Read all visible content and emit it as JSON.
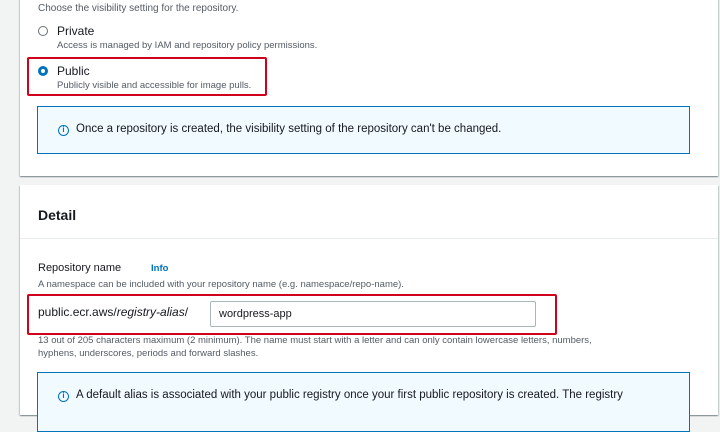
{
  "visibility": {
    "description": "Choose the visibility setting for the repository.",
    "options": [
      {
        "label": "Private",
        "description": "Access is managed by IAM and repository policy permissions.",
        "selected": false
      },
      {
        "label": "Public",
        "description": "Publicly visible and accessible for image pulls.",
        "selected": true
      }
    ],
    "alert": "Once a repository is created, the visibility setting of the repository can't be changed."
  },
  "detail": {
    "title": "Detail",
    "repository_name": {
      "label": "Repository name",
      "info_link": "Info",
      "description": "A namespace can be included with your repository name (e.g. namespace/repo-name).",
      "prefix_domain": "public.ecr.aws/",
      "prefix_alias": "registry-alias",
      "prefix_slash": "/",
      "value": "wordpress-app",
      "constraint_line1": "13 out of 205 characters maximum (2 minimum). The name must start with a letter and can only contain lowercase letters, numbers,",
      "constraint_line2": "hyphens, underscores, periods and forward slashes."
    },
    "alert": "A default alias is associated with your public registry once your first public repository is created. The registry"
  },
  "colors": {
    "accent": "#0073bb",
    "highlight": "#d0021b",
    "alert_bg": "#f1faff",
    "page_bg": "#f2f3f3"
  },
  "icons": [
    "info-icon"
  ]
}
